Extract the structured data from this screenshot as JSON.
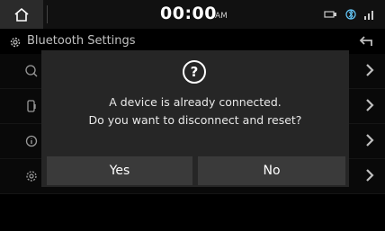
{
  "status": {
    "time": "00:00",
    "ampm": "AM",
    "icons": [
      "usb-icon",
      "bluetooth-phone-icon",
      "signal-icon"
    ]
  },
  "header": {
    "title": "Bluetooth Settings"
  },
  "list_rows": [
    {
      "icon": "bluetooth-connections-icon"
    },
    {
      "icon": "phone-settings-icon"
    },
    {
      "icon": "info-icon"
    },
    {
      "icon": "settings-icon"
    }
  ],
  "dialog": {
    "line1": "A device is already connected.",
    "line2": "Do you want to disconnect and reset?",
    "yes_label": "Yes",
    "no_label": "No"
  },
  "colors": {
    "dialog_bg": "#262626",
    "button_bg": "#3a3a3a",
    "background": "#000000"
  }
}
